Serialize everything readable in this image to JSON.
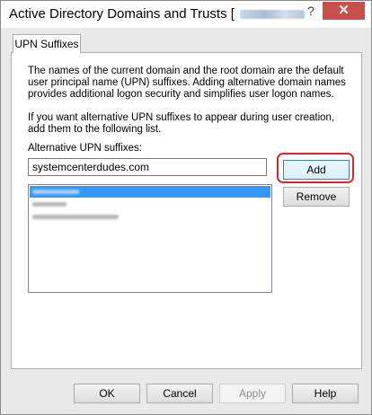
{
  "window": {
    "title": "Active Directory Domains and Trusts [",
    "help_glyph": "?",
    "close_glyph": "✕"
  },
  "tabs": [
    {
      "label": "UPN Suffixes"
    }
  ],
  "panel": {
    "description_1": "The names of the current domain and the root domain are the default user principal name (UPN) suffixes. Adding alternative domain names provides additional logon security and simplifies user logon names.",
    "description_2": "If you want alternative UPN suffixes to appear during user creation, add them to the following list.",
    "field_label": "Alternative UPN suffixes:",
    "input_value": "systemcenterdudes.com",
    "add_label": "Add",
    "remove_label": "Remove",
    "list_items": [
      {
        "selected": true
      },
      {
        "selected": false
      },
      {
        "selected": false
      }
    ]
  },
  "footer": {
    "ok_label": "OK",
    "cancel_label": "Cancel",
    "apply_label": "Apply",
    "help_label": "Help"
  },
  "colors": {
    "selection": "#3399ff",
    "close_button": "#c7504b",
    "highlight_annotation": "#e0252b"
  }
}
